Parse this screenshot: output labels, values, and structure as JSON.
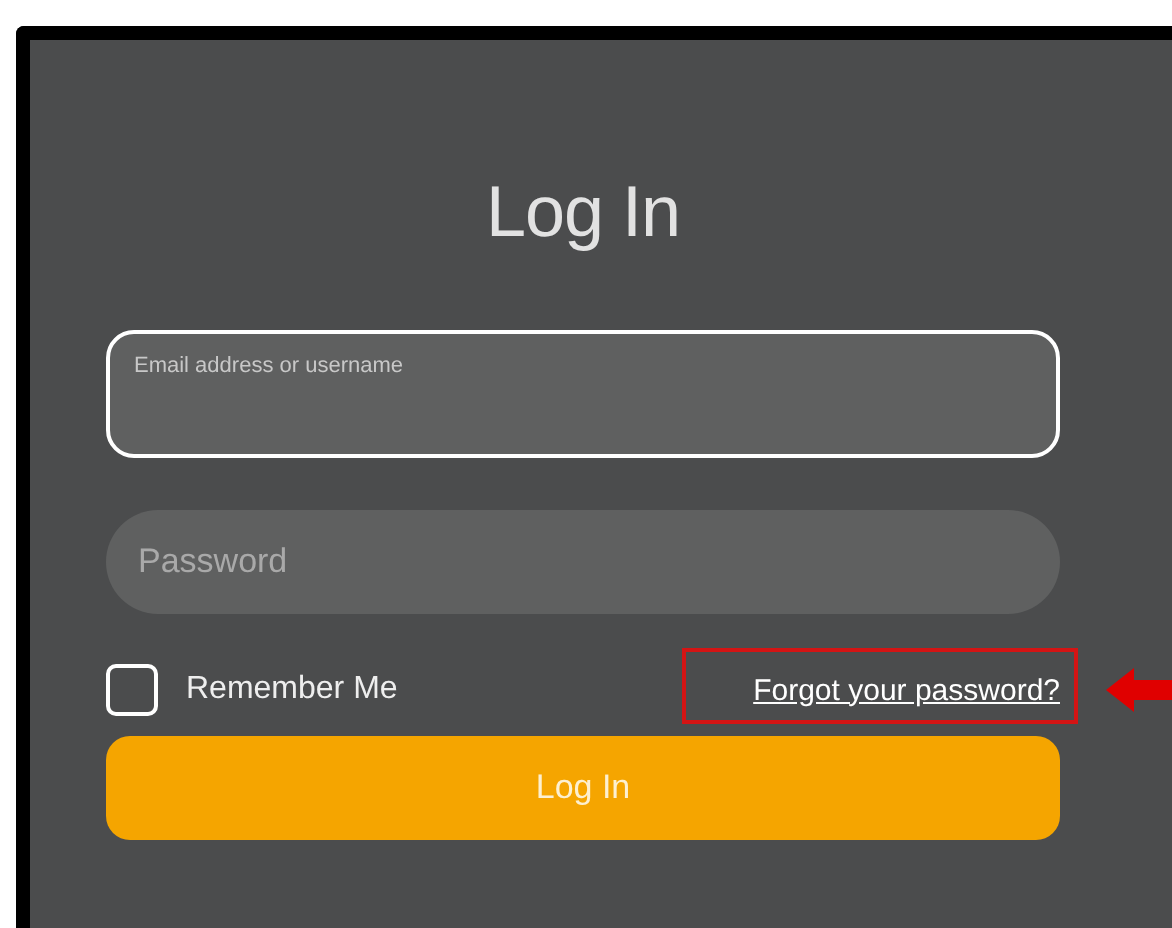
{
  "title": "Log In",
  "email_field": {
    "label": "Email address or username",
    "focused": true
  },
  "password_field": {
    "placeholder": "Password"
  },
  "remember_me": {
    "label": "Remember Me",
    "checked": false
  },
  "forgot_link": {
    "label": "Forgot your password?",
    "highlighted": true
  },
  "login_button": {
    "label": "Log In"
  }
}
